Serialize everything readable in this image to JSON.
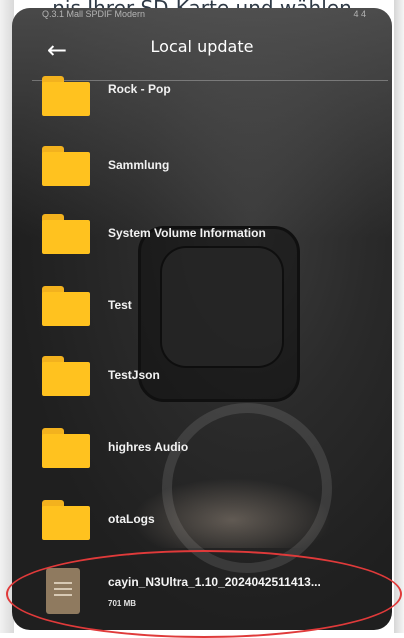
{
  "top_caption": "nis Ihrer SD-Karte und wählen",
  "status_bar": {
    "left_text": "Q.3.1 Mall  SPDIF  Modern",
    "right_text": "4 4"
  },
  "app_bar": {
    "title": "Local update",
    "back_icon": "arrow-left-icon"
  },
  "folders": [
    {
      "name": "Rock - Pop"
    },
    {
      "name": "Sammlung"
    },
    {
      "name": "System Volume Information"
    },
    {
      "name": "Test"
    },
    {
      "name": "TestJson"
    },
    {
      "name": "highres Audio"
    },
    {
      "name": "otaLogs"
    }
  ],
  "file": {
    "name": "cayin_N3Ultra_1.10_2024042511413...",
    "size": "701 MB",
    "icon": "document-icon"
  },
  "annotation": {
    "color": "#e03a3a"
  },
  "colors": {
    "folder": "#ffc21f",
    "screen_bg": "#262626",
    "text": "#ffffff"
  }
}
